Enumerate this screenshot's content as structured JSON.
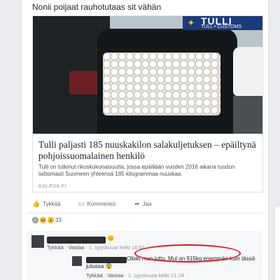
{
  "post": {
    "text": "Nonii poijaat rauhotutaas sit vähän"
  },
  "customs_logo": {
    "name": "TULLI",
    "subtitle": "TULL • CUSTOMS"
  },
  "link": {
    "title": "Tulli paljasti 185 nuuskakilon salakuljetuksen – epäiltynä pohjoissuomalainen henkilö",
    "description": "Tulli on tutkinut rikoskokonaisuutta, jossa epäillään vuoden 2016 aikana tuodun laittomasti Suomeen yhteensä 185 kilogrammaa nuuskaa.",
    "source": "KALEVA.FI"
  },
  "actions": {
    "like": "Tykkää",
    "comment": "Kommentoi",
    "share": "Jaa"
  },
  "reactions": {
    "count": "33"
  },
  "comments": [
    {
      "text": "😊",
      "like": "Tykkää",
      "reply": "Vastaa",
      "time": "1. syyskuuta kello 16:02"
    },
    {
      "text_line1": "Oliski mun juttu. Mul on 915kg enemmän kuin tässä",
      "text_line2": "jutussa 😨",
      "like": "Tykkää",
      "reply": "Vastaa",
      "time": "1. syyskuuta kello 21:24"
    }
  ],
  "colors": {
    "link_blue": "#365899",
    "annotation_red": "#e0161b",
    "customs_blue": "#1b3a7a"
  }
}
